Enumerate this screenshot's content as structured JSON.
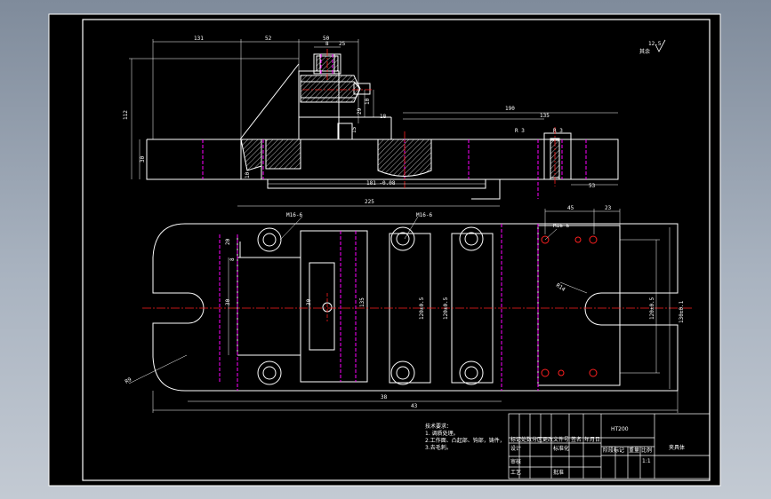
{
  "colors": {
    "background": "#000000",
    "viewport": "#9aa4b2",
    "outline": "#ffffff",
    "centerline": "#ff2020",
    "hidden": "#ff00ff",
    "dimension": "#ffffff",
    "hatch": "#ffffff"
  },
  "roughness": {
    "value": "12.5",
    "label": "其余"
  },
  "dims_top": {
    "d131": "131",
    "d52": "52",
    "d50": "50",
    "d8": "8",
    "d25": "25",
    "d112": "112",
    "d30": "30",
    "d10": "10",
    "d18": "18",
    "d29": "29",
    "d15": "15",
    "d190": "190",
    "d135": "135",
    "d53": "53",
    "d10b": "10",
    "d181": "181 -0.08",
    "d225": "225",
    "r8": "R 3",
    "r16": "R 3"
  },
  "dims_bottom": {
    "m16a": "M16-6",
    "m16b": "M16-6",
    "m16c": "M16-6",
    "d45": "45",
    "d23": "23",
    "d38": "38",
    "d43": "43",
    "d20": "20",
    "d8": "8",
    "d30": "30",
    "d30b": "30",
    "d135": "135",
    "d120a": "120±0.5",
    "d120b": "120±0.5",
    "d120c": "120±0.5",
    "d130": "130±0.1",
    "r14": "R14",
    "r9": "R9"
  },
  "notes": {
    "title": "技术要求：",
    "line1": "1. 调质处理。",
    "line2": "2.工作面、凸起部、钩部，铸件，",
    "line3": "3.去毛刺。"
  },
  "title_block": {
    "material": "HT200",
    "part_name": "夹具体",
    "scale": "1:1",
    "labels": [
      "标记",
      "处数",
      "分区",
      "更改文件号",
      "签名",
      "年月日"
    ],
    "row2": [
      "设计",
      "",
      "",
      "标准化",
      "",
      ""
    ],
    "row3": [
      "审核",
      "",
      "",
      "",
      "",
      ""
    ],
    "row4": [
      "工艺",
      "",
      "",
      "批准",
      "",
      ""
    ],
    "stage_labels": [
      "阶段标记",
      "重量",
      "比例"
    ]
  }
}
